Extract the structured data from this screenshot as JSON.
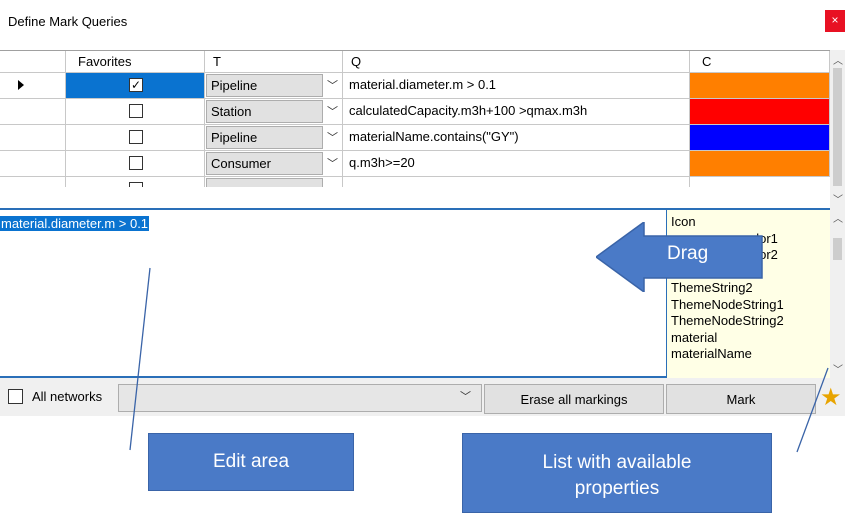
{
  "window": {
    "title": "Define Mark Queries",
    "close": "×"
  },
  "columns": [
    "Favorites",
    "T",
    "Q",
    "C"
  ],
  "rows": [
    {
      "favorite": "✓",
      "type": "Pipeline",
      "query": "material.diameter.m > 0.1",
      "color": "#ff7f00",
      "selected": true
    },
    {
      "favorite": "",
      "type": "Station",
      "query": "calculatedCapacity.m3h+100 >qmax.m3h",
      "color": "#ff0000",
      "selected": false
    },
    {
      "favorite": "",
      "type": "Pipeline",
      "query": "materialName.contains(\"GY\")",
      "color": "#0000ff",
      "selected": false
    },
    {
      "favorite": "",
      "type": "Consumer",
      "query": "q.m3h>=20",
      "color": "#ff7f00",
      "selected": false
    }
  ],
  "edit": {
    "text": "material.diameter.m > 0.1"
  },
  "properties": [
    "Icon",
    "olor1",
    "olor2",
    "ThemeString2",
    "ThemeNodeString1",
    "ThemeNodeString2",
    "material",
    "materialName"
  ],
  "bottom": {
    "all_networks": "All networks",
    "erase": "Erase all markings",
    "mark": "Mark"
  },
  "callouts": {
    "drag": "Drag",
    "edit_area": "Edit area",
    "list_props": "List with available properties"
  }
}
